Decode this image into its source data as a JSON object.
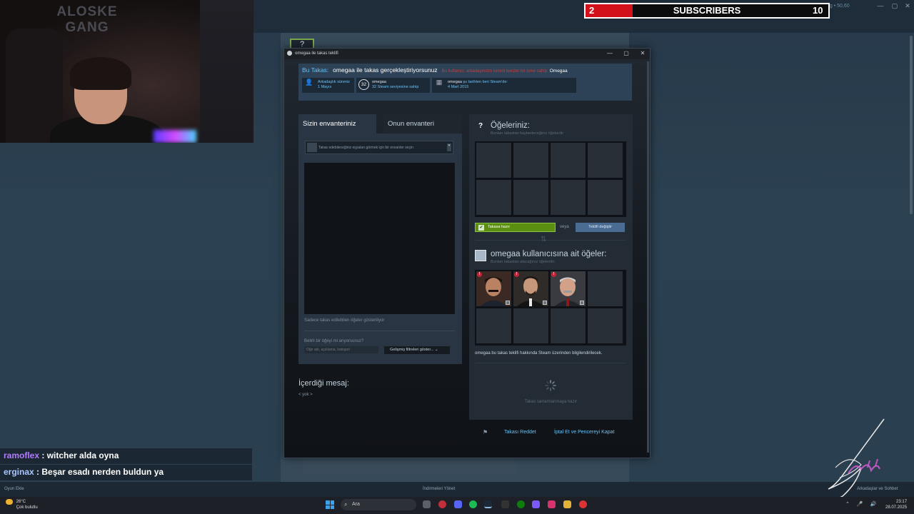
{
  "overlay": {
    "webcam_text": [
      "ALOSKE",
      "GANG"
    ],
    "sub_counter": {
      "current": "2",
      "label": "SUBSCRIBERS",
      "goal": "10",
      "progress": 0.2
    },
    "chat": [
      {
        "user": "ramoflex",
        "message": " : witcher alda oyna"
      },
      {
        "user": "erginax",
        "message": " : Beşar esadı nerden buldun ya"
      }
    ]
  },
  "steam_bg": {
    "username": "aloskegang • 50,60",
    "footer": {
      "add_game": "Oyun Ekle",
      "downloads": "İndirmeleri Yönet",
      "friends_chat": "Arkadaşlar ve Sohbet"
    }
  },
  "trade": {
    "window_title": "omegaa ile takas teklifi",
    "banner": {
      "label": "Bu Takas:",
      "title": "omegaa ile takas gerçekleştiriyorsunuz",
      "warning": "Bu kullanıcı, arkadaşınızın isimini benzer bir isme sahip:",
      "name": "Omegaa"
    },
    "info": [
      {
        "label": "Arkadaşlık süreniz",
        "value": "1 Mayıs"
      },
      {
        "label": "omegaa",
        "value": "32 Steam seviyesine sahip",
        "level": "32"
      },
      {
        "label": "omegaa",
        "label_suffix": " şu tarihten beri Steam'de:",
        "value": "4 Mart 2015"
      }
    ],
    "tabs": {
      "yours": "Sizin envanteriniz",
      "theirs": "Onun envanteri"
    },
    "inventory": {
      "select_placeholder": "Takas edebileceğiniz eşyaları görmek için bir envanter seçin",
      "note": "Sadece takas edilebilen öğeler gösteriliyor",
      "find_label": "Belirli bir öğeyi mi arıyorsunuz?",
      "find_placeholder": "Öğe adı, açıklama, kategori",
      "advanced_filters": "Gelişmiş filtreleri göster..."
    },
    "message": {
      "label": "İçerdiği mesaj:",
      "value": "< yok >"
    },
    "your_items": {
      "title": "Öğeleriniz:",
      "subtitle": "Bunları takastan kaybedeceğiniz öğelerdir."
    },
    "ready_label": "Takasa hazır",
    "or_label": "veya",
    "change_offer": "Teklifi değiştir",
    "their_items": {
      "title": "omegaa kullanıcısına ait öğeler:",
      "subtitle": "Bunları takastan alacağınız öğelerdir."
    },
    "notify": "omegaa bu takas teklifi hakkında Steam üzerinden bilgilendirilecek.",
    "waiting": "Takas tamamlanmaya hazır",
    "decline": "Takası Reddet",
    "cancel": "İptal Et ve Pencereyi Kapat"
  },
  "taskbar": {
    "weather_temp": "26°C",
    "weather_desc": "Çok bulutlu",
    "search_placeholder": "Ara",
    "time": "23:17",
    "date": "28.07.2025"
  }
}
